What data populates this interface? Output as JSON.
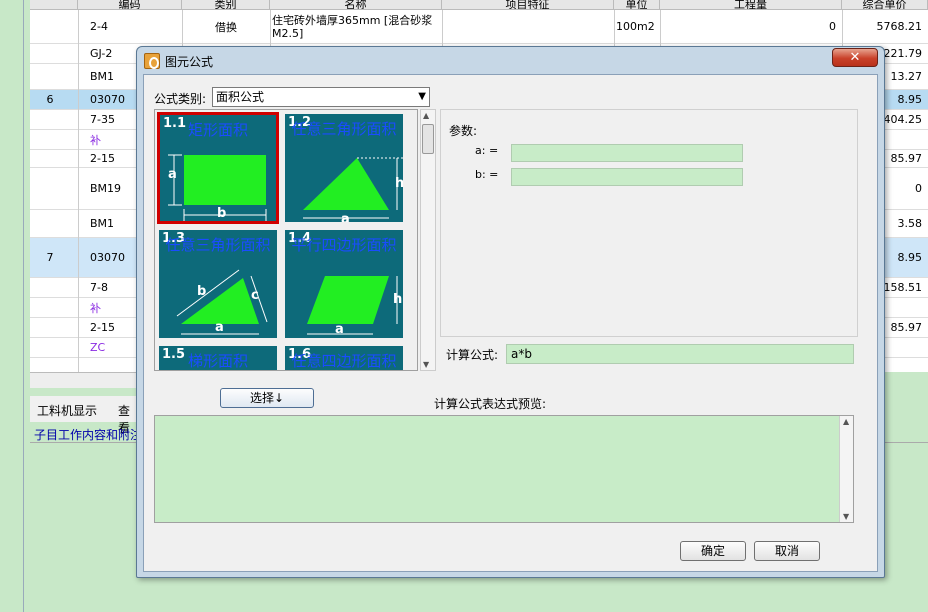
{
  "background": {
    "header": [
      "编码",
      "类别",
      "名称",
      "项目特征",
      "单位",
      "工程量",
      "综合单价"
    ],
    "rows": [
      {
        "no": "",
        "code": "2-4",
        "type": "借换",
        "name": "住宅砖外墙厚365mm [混合砂浆M2.5]",
        "unit": "100m2",
        "qty": "0",
        "price": "5768.21"
      },
      {
        "no": "",
        "code": "GJ-2",
        "type": "",
        "name": "",
        "unit": "",
        "qty": "",
        "price": "221.79"
      },
      {
        "no": "",
        "code": "BM1",
        "type": "",
        "name": "",
        "unit": "",
        "qty": "",
        "price": "13.27"
      },
      {
        "no": "6",
        "code": "03070",
        "type": "",
        "name": "",
        "unit": "",
        "qty": "",
        "price": "8.95"
      },
      {
        "no": "",
        "code": "7-35",
        "type": "",
        "name": "",
        "unit": "",
        "qty": "",
        "price": "404.25"
      },
      {
        "no": "",
        "code": "补",
        "type": "",
        "name": "",
        "unit": "",
        "qty": "",
        "price": ""
      },
      {
        "no": "",
        "code": "2-15",
        "type": "",
        "name": "",
        "unit": "",
        "qty": "",
        "price": "85.97"
      },
      {
        "no": "",
        "code": "BM19",
        "type": "",
        "name": "",
        "unit": "",
        "qty": "",
        "price": "0"
      },
      {
        "no": "",
        "code": "BM1",
        "type": "",
        "name": "",
        "unit": "",
        "qty": "",
        "price": "3.58"
      },
      {
        "no": "7",
        "code": "03070",
        "type": "",
        "name": "",
        "unit": "",
        "qty": "",
        "price": "8.95"
      },
      {
        "no": "",
        "code": "7-8",
        "type": "",
        "name": "",
        "unit": "",
        "qty": "",
        "price": "158.51"
      },
      {
        "no": "",
        "code": "补",
        "type": "",
        "name": "",
        "unit": "",
        "qty": "",
        "price": ""
      },
      {
        "no": "",
        "code": "2-15",
        "type": "",
        "name": "",
        "unit": "",
        "qty": "",
        "price": "85.97"
      },
      {
        "no": "",
        "code": "ZC",
        "type": "",
        "name": "",
        "unit": "",
        "qty": "",
        "price": ""
      }
    ],
    "tab1": "工料机显示",
    "tab2": "查看",
    "info": "子目工作内容和附注"
  },
  "dialog": {
    "title": "图元公式",
    "close_label": "✕",
    "category_label": "公式类别:",
    "category_value": "面积公式",
    "shapes": [
      {
        "num": "1.1",
        "name": "矩形面积",
        "a": "a",
        "b": "b"
      },
      {
        "num": "1.2",
        "name": "任意三角形面积",
        "a": "a",
        "h": "h"
      },
      {
        "num": "1.3",
        "name": "任意三角形面积",
        "a": "a",
        "b": "b",
        "c": "c"
      },
      {
        "num": "1.4",
        "name": "平行四边形面积",
        "a": "a",
        "h": "h"
      },
      {
        "num": "1.5",
        "name": "梯形面积"
      },
      {
        "num": "1.6",
        "name": "任意四边形面积"
      }
    ],
    "params_label": "参数:",
    "params": [
      {
        "label": "a: =",
        "value": ""
      },
      {
        "label": "b: =",
        "value": ""
      }
    ],
    "formula_label": "计算公式:",
    "formula_value": "a*b",
    "select_button": "选择↓",
    "preview_label": "计算公式表达式预览:",
    "ok_button": "确定",
    "cancel_button": "取消"
  },
  "colors": {
    "tile_bg": "#0d6a7a",
    "shape_fill": "#22ee22",
    "selected_border": "#d00000",
    "field_bg": "#c8ecc8"
  }
}
